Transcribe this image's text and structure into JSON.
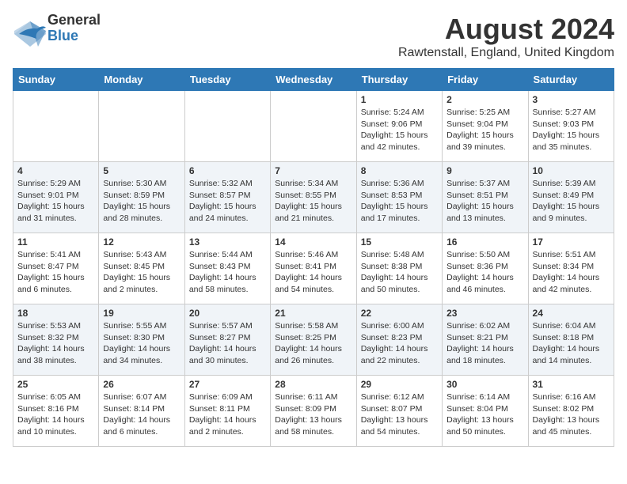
{
  "header": {
    "logo_general": "General",
    "logo_blue": "Blue",
    "title": "August 2024",
    "subtitle": "Rawtenstall, England, United Kingdom"
  },
  "weekdays": [
    "Sunday",
    "Monday",
    "Tuesday",
    "Wednesday",
    "Thursday",
    "Friday",
    "Saturday"
  ],
  "weeks": [
    [
      {
        "day": "",
        "sunrise": "",
        "sunset": "",
        "daylight": ""
      },
      {
        "day": "",
        "sunrise": "",
        "sunset": "",
        "daylight": ""
      },
      {
        "day": "",
        "sunrise": "",
        "sunset": "",
        "daylight": ""
      },
      {
        "day": "",
        "sunrise": "",
        "sunset": "",
        "daylight": ""
      },
      {
        "day": "1",
        "sunrise": "5:24 AM",
        "sunset": "9:06 PM",
        "daylight": "15 hours and 42 minutes."
      },
      {
        "day": "2",
        "sunrise": "5:25 AM",
        "sunset": "9:04 PM",
        "daylight": "15 hours and 39 minutes."
      },
      {
        "day": "3",
        "sunrise": "5:27 AM",
        "sunset": "9:03 PM",
        "daylight": "15 hours and 35 minutes."
      }
    ],
    [
      {
        "day": "4",
        "sunrise": "5:29 AM",
        "sunset": "9:01 PM",
        "daylight": "15 hours and 31 minutes."
      },
      {
        "day": "5",
        "sunrise": "5:30 AM",
        "sunset": "8:59 PM",
        "daylight": "15 hours and 28 minutes."
      },
      {
        "day": "6",
        "sunrise": "5:32 AM",
        "sunset": "8:57 PM",
        "daylight": "15 hours and 24 minutes."
      },
      {
        "day": "7",
        "sunrise": "5:34 AM",
        "sunset": "8:55 PM",
        "daylight": "15 hours and 21 minutes."
      },
      {
        "day": "8",
        "sunrise": "5:36 AM",
        "sunset": "8:53 PM",
        "daylight": "15 hours and 17 minutes."
      },
      {
        "day": "9",
        "sunrise": "5:37 AM",
        "sunset": "8:51 PM",
        "daylight": "15 hours and 13 minutes."
      },
      {
        "day": "10",
        "sunrise": "5:39 AM",
        "sunset": "8:49 PM",
        "daylight": "15 hours and 9 minutes."
      }
    ],
    [
      {
        "day": "11",
        "sunrise": "5:41 AM",
        "sunset": "8:47 PM",
        "daylight": "15 hours and 6 minutes."
      },
      {
        "day": "12",
        "sunrise": "5:43 AM",
        "sunset": "8:45 PM",
        "daylight": "15 hours and 2 minutes."
      },
      {
        "day": "13",
        "sunrise": "5:44 AM",
        "sunset": "8:43 PM",
        "daylight": "14 hours and 58 minutes."
      },
      {
        "day": "14",
        "sunrise": "5:46 AM",
        "sunset": "8:41 PM",
        "daylight": "14 hours and 54 minutes."
      },
      {
        "day": "15",
        "sunrise": "5:48 AM",
        "sunset": "8:38 PM",
        "daylight": "14 hours and 50 minutes."
      },
      {
        "day": "16",
        "sunrise": "5:50 AM",
        "sunset": "8:36 PM",
        "daylight": "14 hours and 46 minutes."
      },
      {
        "day": "17",
        "sunrise": "5:51 AM",
        "sunset": "8:34 PM",
        "daylight": "14 hours and 42 minutes."
      }
    ],
    [
      {
        "day": "18",
        "sunrise": "5:53 AM",
        "sunset": "8:32 PM",
        "daylight": "14 hours and 38 minutes."
      },
      {
        "day": "19",
        "sunrise": "5:55 AM",
        "sunset": "8:30 PM",
        "daylight": "14 hours and 34 minutes."
      },
      {
        "day": "20",
        "sunrise": "5:57 AM",
        "sunset": "8:27 PM",
        "daylight": "14 hours and 30 minutes."
      },
      {
        "day": "21",
        "sunrise": "5:58 AM",
        "sunset": "8:25 PM",
        "daylight": "14 hours and 26 minutes."
      },
      {
        "day": "22",
        "sunrise": "6:00 AM",
        "sunset": "8:23 PM",
        "daylight": "14 hours and 22 minutes."
      },
      {
        "day": "23",
        "sunrise": "6:02 AM",
        "sunset": "8:21 PM",
        "daylight": "14 hours and 18 minutes."
      },
      {
        "day": "24",
        "sunrise": "6:04 AM",
        "sunset": "8:18 PM",
        "daylight": "14 hours and 14 minutes."
      }
    ],
    [
      {
        "day": "25",
        "sunrise": "6:05 AM",
        "sunset": "8:16 PM",
        "daylight": "14 hours and 10 minutes."
      },
      {
        "day": "26",
        "sunrise": "6:07 AM",
        "sunset": "8:14 PM",
        "daylight": "14 hours and 6 minutes."
      },
      {
        "day": "27",
        "sunrise": "6:09 AM",
        "sunset": "8:11 PM",
        "daylight": "14 hours and 2 minutes."
      },
      {
        "day": "28",
        "sunrise": "6:11 AM",
        "sunset": "8:09 PM",
        "daylight": "13 hours and 58 minutes."
      },
      {
        "day": "29",
        "sunrise": "6:12 AM",
        "sunset": "8:07 PM",
        "daylight": "13 hours and 54 minutes."
      },
      {
        "day": "30",
        "sunrise": "6:14 AM",
        "sunset": "8:04 PM",
        "daylight": "13 hours and 50 minutes."
      },
      {
        "day": "31",
        "sunrise": "6:16 AM",
        "sunset": "8:02 PM",
        "daylight": "13 hours and 45 minutes."
      }
    ]
  ]
}
